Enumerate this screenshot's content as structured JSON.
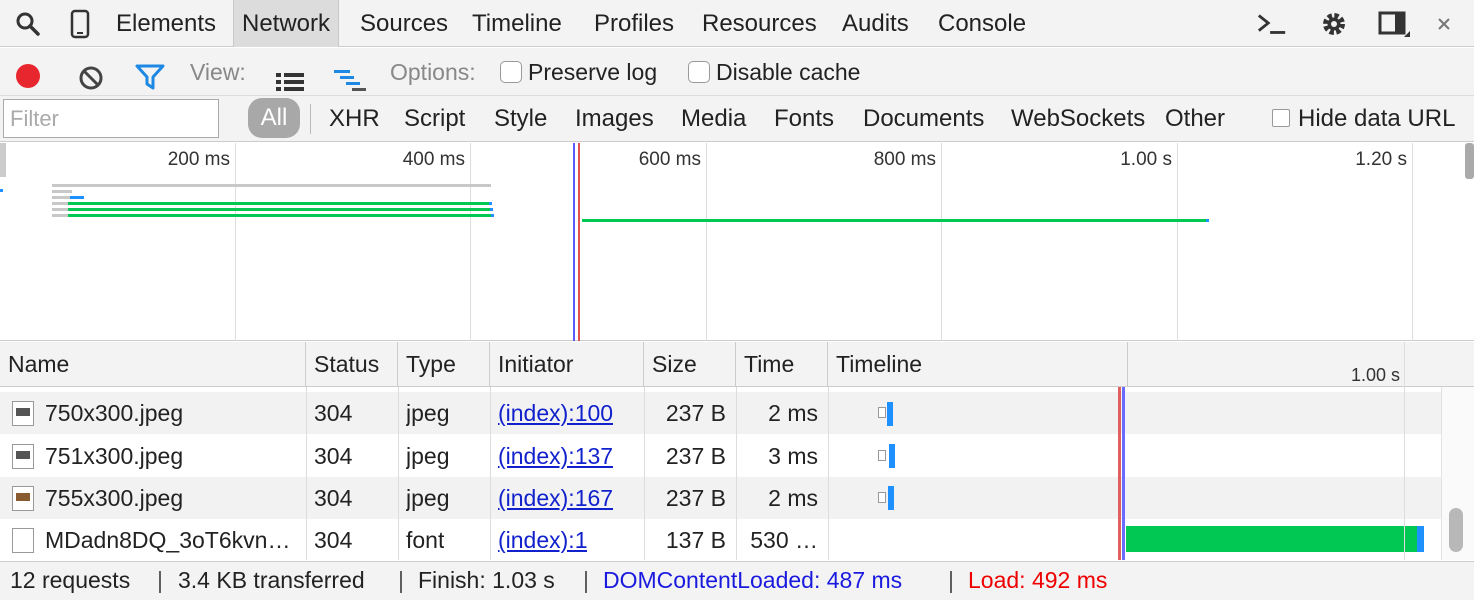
{
  "tabs": [
    "Elements",
    "Network",
    "Sources",
    "Timeline",
    "Profiles",
    "Resources",
    "Audits",
    "Console"
  ],
  "active_tab": "Network",
  "toolbar": {
    "view_label": "View:",
    "options_label": "Options:",
    "preserve_log": "Preserve log",
    "disable_cache": "Disable cache"
  },
  "filter": {
    "placeholder": "Filter",
    "all": "All",
    "types": [
      "XHR",
      "Script",
      "Style",
      "Images",
      "Media",
      "Fonts",
      "Documents",
      "WebSockets",
      "Other"
    ],
    "hide_data_url": "Hide data URL"
  },
  "overview": {
    "ticks": [
      "200 ms",
      "400 ms",
      "600 ms",
      "800 ms",
      "1.00 s",
      "1.20 s"
    ]
  },
  "table": {
    "columns": [
      "Name",
      "Status",
      "Type",
      "Initiator",
      "Size",
      "Time",
      "Timeline"
    ],
    "timeline_tick": "1.00 s",
    "rows": [
      {
        "name": "750x300.jpeg",
        "status": "304",
        "type": "jpeg",
        "initiator": "(index):100",
        "size": "237 B",
        "time": "2 ms"
      },
      {
        "name": "751x300.jpeg",
        "status": "304",
        "type": "jpeg",
        "initiator": "(index):137",
        "size": "237 B",
        "time": "3 ms"
      },
      {
        "name": "755x300.jpeg",
        "status": "304",
        "type": "jpeg",
        "initiator": "(index):167",
        "size": "237 B",
        "time": "2 ms"
      },
      {
        "name": "MDadn8DQ_3oT6kvn…",
        "status": "304",
        "type": "font",
        "initiator": "(index):1",
        "size": "137 B",
        "time": "530 …"
      }
    ]
  },
  "status": {
    "requests": "12 requests",
    "transferred": "3.4 KB transferred",
    "finish": "Finish: 1.03 s",
    "dom": "DOMContentLoaded: 487 ms",
    "load": "Load: 492 ms"
  },
  "colors": {
    "dom_line": "#5a5aff",
    "load_line": "#e05050",
    "bar_green": "#00c853",
    "bar_blue": "#1e90ff",
    "dom_text": "#1a1adf",
    "load_text": "#ee0000"
  }
}
